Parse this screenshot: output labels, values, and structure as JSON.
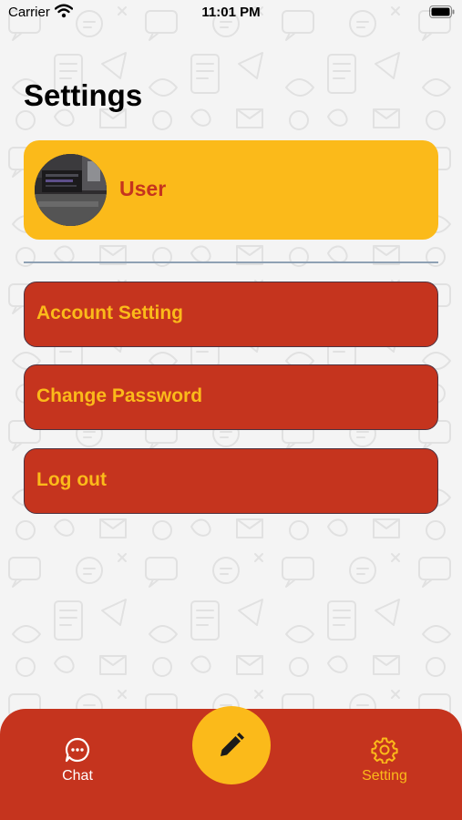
{
  "status_bar": {
    "carrier": "Carrier",
    "time": "11:01 PM"
  },
  "header": {
    "title": "Settings"
  },
  "profile": {
    "name": "User"
  },
  "menu": {
    "items": [
      {
        "label": "Account Setting"
      },
      {
        "label": "Change Password"
      },
      {
        "label": "Log out"
      }
    ]
  },
  "tab_bar": {
    "tabs": [
      {
        "label": "Chat",
        "icon": "chat-bubble-icon",
        "active": false
      },
      {
        "label": "Setting",
        "icon": "gear-icon",
        "active": true
      }
    ],
    "center_button_icon": "pencil-icon"
  },
  "colors": {
    "accent_red": "#c5341e",
    "accent_yellow": "#fbba1a",
    "background": "#f4f4f4"
  }
}
